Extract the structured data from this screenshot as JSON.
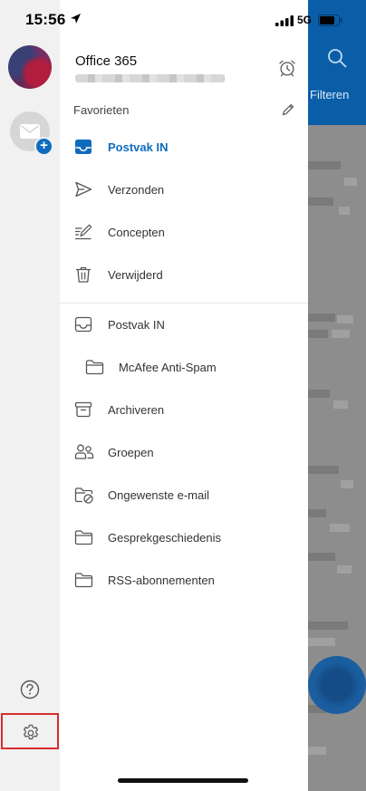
{
  "status_bar": {
    "time": "15:56",
    "network": "5G"
  },
  "account": {
    "name": "Office 365"
  },
  "favorites": {
    "label": "Favorieten"
  },
  "favorite_items": [
    {
      "label": "Postvak IN",
      "icon": "inbox-icon"
    },
    {
      "label": "Verzonden",
      "icon": "send-icon"
    },
    {
      "label": "Concepten",
      "icon": "drafts-icon"
    },
    {
      "label": "Verwijderd",
      "icon": "trash-icon"
    }
  ],
  "folder_items": [
    {
      "label": "Postvak IN",
      "icon": "inbox-icon"
    },
    {
      "label": "McAfee Anti-Spam",
      "icon": "folder-icon"
    },
    {
      "label": "Archiveren",
      "icon": "archive-icon"
    },
    {
      "label": "Groepen",
      "icon": "groups-icon"
    },
    {
      "label": "Ongewenste e-mail",
      "icon": "junk-folder-icon"
    },
    {
      "label": "Gesprekgeschiedenis",
      "icon": "folder-icon"
    },
    {
      "label": "RSS-abonnementen",
      "icon": "folder-icon"
    }
  ],
  "background": {
    "filter_label": "Filteren"
  },
  "colors": {
    "accent": "#0f6cbd",
    "highlight_border": "#d62d2d"
  }
}
